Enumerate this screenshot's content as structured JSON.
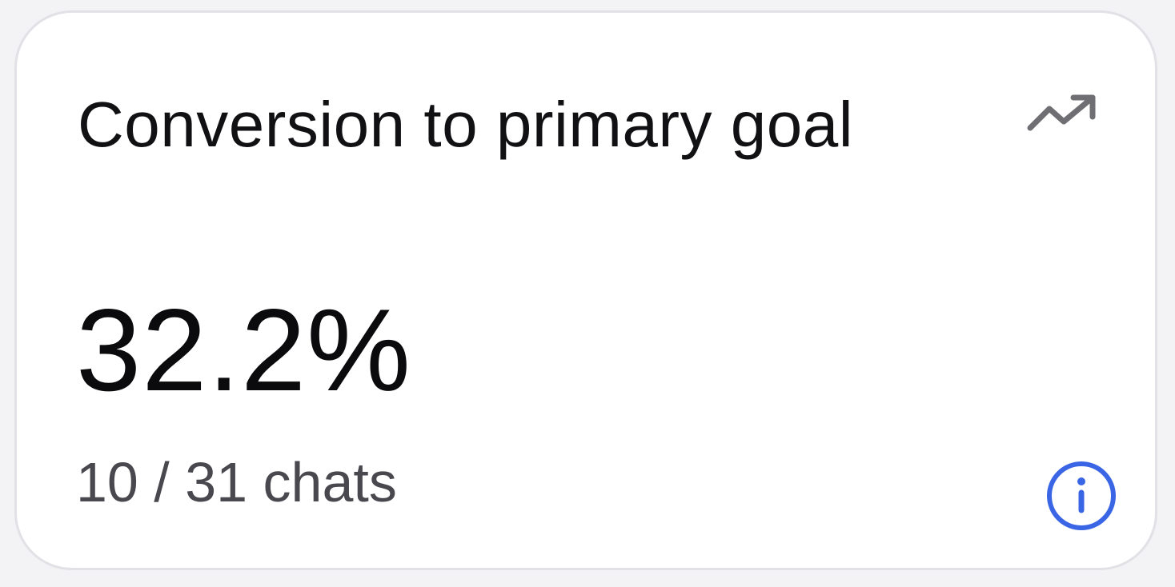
{
  "card": {
    "title": "Conversion to primary goal",
    "value": "32.2%",
    "subtext": "10 / 31 chats"
  },
  "icons": {
    "trend": "trending-up-icon",
    "info": "info-icon"
  },
  "colors": {
    "title": "#111114",
    "value": "#0b0b0d",
    "subtext": "#48484e",
    "trend_icon": "#6f6f73",
    "info_icon": "#3a66e6",
    "card_border": "#e1e1e6"
  }
}
